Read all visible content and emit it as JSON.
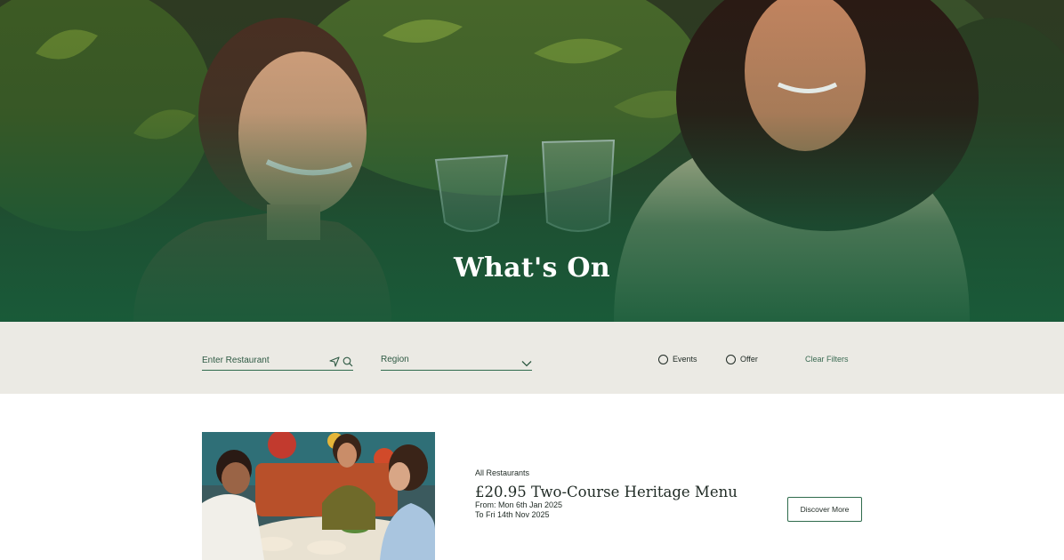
{
  "hero": {
    "title": "What's On",
    "image": "photo of two women toasting with wine glasses in front of green plants"
  },
  "filters": {
    "restaurant_placeholder": "Enter Restaurant",
    "restaurant_icons": [
      "location-arrow-icon",
      "search-icon"
    ],
    "region_label": "Region",
    "region_icon": "chevron-down-icon",
    "events_label": "Events",
    "offer_label": "Offer",
    "clear_label": "Clear Filters"
  },
  "listing": {
    "image": "photo of diners sharing a meal at a restaurant table with colorful floral wallpaper",
    "tag": "All Restaurants",
    "title": "£20.95 Two-Course Heritage Menu",
    "date_from": "From: Mon 6th Jan 2025",
    "date_to": "To Fri 14th Nov 2025",
    "button_label": "Discover More"
  },
  "colors": {
    "brand_green": "#2f6b4c",
    "filter_bar_bg": "#ebeae4",
    "hero_overlay": "#185c3a"
  }
}
